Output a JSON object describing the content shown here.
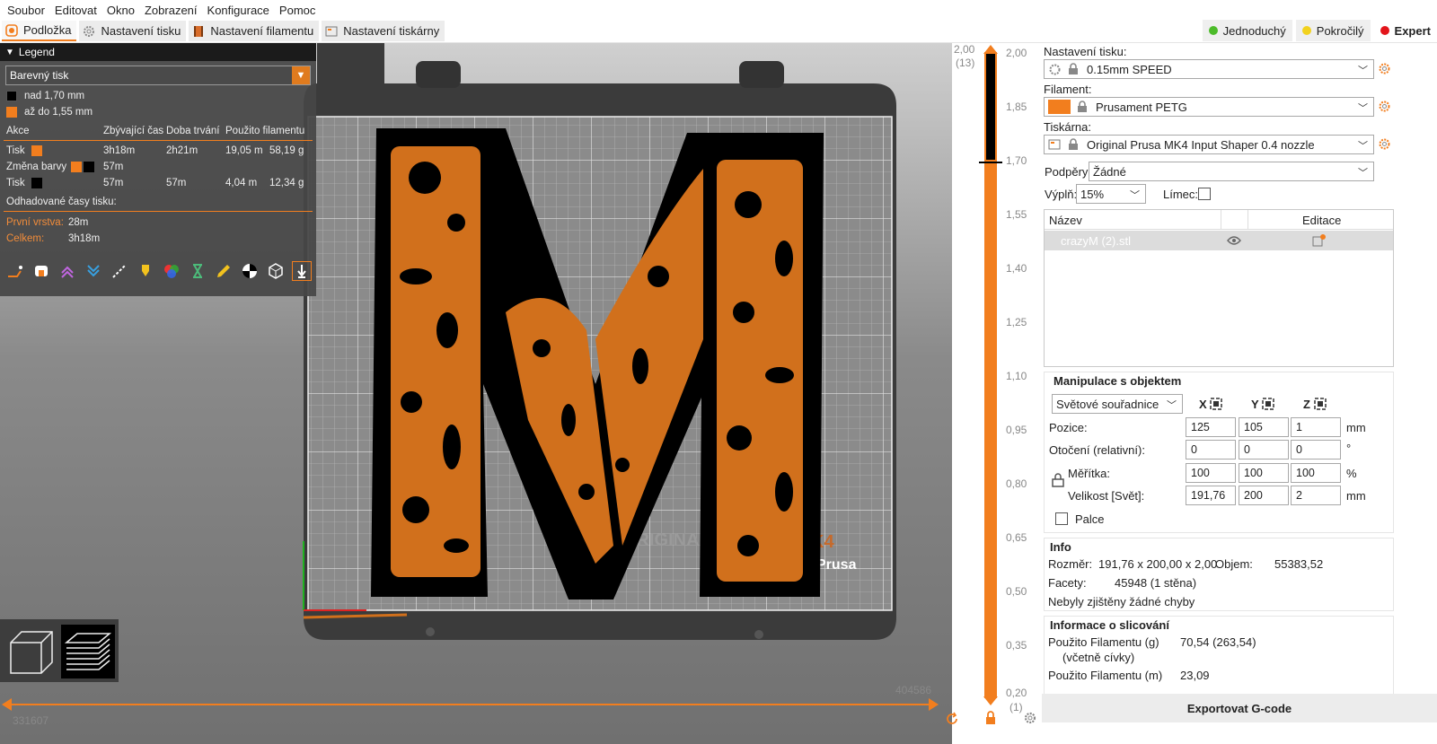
{
  "menu": [
    "Soubor",
    "Editovat",
    "Okno",
    "Zobrazení",
    "Konfigurace",
    "Pomoc"
  ],
  "tabs": [
    {
      "label": "Podložka",
      "icon": "plater-icon"
    },
    {
      "label": "Nastavení tisku",
      "icon": "gear-icon"
    },
    {
      "label": "Nastavení filamentu",
      "icon": "spool-icon"
    },
    {
      "label": "Nastavení tiskárny",
      "icon": "printer-icon"
    }
  ],
  "modes": [
    {
      "label": "Jednoduchý",
      "color": "#4cbb2a"
    },
    {
      "label": "Pokročilý",
      "color": "#f2d21e"
    },
    {
      "label": "Expert",
      "color": "#e3151b"
    }
  ],
  "legend": {
    "title": "Legend",
    "view_type": "Barevný tisk",
    "ranges": [
      {
        "label": "nad 1,70 mm",
        "color": "#000000"
      },
      {
        "label": "až do 1,55 mm",
        "color": "#f27e1e"
      }
    ],
    "columns": [
      "Akce",
      "Zbývající čas",
      "Doba trvání",
      "Použito filamentu"
    ],
    "rows": [
      {
        "action": "Tisk",
        "remaining": "3h18m",
        "duration": "2h21m",
        "length": "19,05 m",
        "weight": "58,19 g"
      },
      {
        "action": "Změna barvy",
        "remaining": "57m",
        "duration": "",
        "length": "",
        "weight": ""
      },
      {
        "action": "Tisk",
        "remaining": "57m",
        "duration": "57m",
        "length": "4,04 m",
        "weight": "12,34 g"
      }
    ],
    "estimates_title": "Odhadované časy tisku:",
    "first_layer_label": "První vrstva:",
    "first_layer_value": "28m",
    "total_label": "Celkem:",
    "total_value": "3h18m"
  },
  "bed_logo": {
    "text1": "ORIGINA",
    "text2": "K4",
    "text3": "Prusa"
  },
  "vertical_slider": {
    "top_value": "2,00",
    "top_layer": "(13)",
    "bottom_value": "0,20",
    "bottom_layer": "(1)",
    "ticks": [
      "2,00",
      "1,85",
      "1,70",
      "1,55",
      "1,40",
      "1,25",
      "1,10",
      "0,95",
      "0,80",
      "0,65",
      "0,50",
      "0,35",
      "0,20"
    ],
    "color_change_at": "1,70"
  },
  "horizontal_slider": {
    "left_value": "331607",
    "right_value": "404586"
  },
  "right_panel": {
    "print_settings_label": "Nastavení tisku:",
    "print_settings_value": "0.15mm SPEED",
    "filament_label": "Filament:",
    "filament_value": "Prusament PETG",
    "filament_color": "#f27e1e",
    "printer_label": "Tiskárna:",
    "printer_value": "Original Prusa MK4 Input Shaper 0.4 nozzle",
    "supports_label": "Podpěry:",
    "supports_value": "Žádné",
    "infill_label": "Výplň:",
    "infill_value": "15%",
    "brim_label": "Límec:",
    "list_col_name": "Název",
    "list_col_edit": "Editace",
    "object_name": "crazyM (2).stl",
    "manip_title": "Manipulace s objektem",
    "coord_system": "Světové souřadnice",
    "axes": [
      "X",
      "Y",
      "Z"
    ],
    "position_label": "Pozice:",
    "position": [
      "125",
      "105",
      "1"
    ],
    "position_unit": "mm",
    "rotation_label": "Otočení (relativní):",
    "rotation": [
      "0",
      "0",
      "0"
    ],
    "rotation_unit": "°",
    "scale_label": "Měřítka:",
    "scale": [
      "100",
      "100",
      "100"
    ],
    "scale_unit": "%",
    "size_label": "Velikost [Svět]:",
    "size": [
      "191,76",
      "200",
      "2"
    ],
    "size_unit": "mm",
    "inches_label": "Palce",
    "info_title": "Info",
    "size_info_label": "Rozměr:",
    "size_info_value": "191,76 x 200,00 x 2,00",
    "volume_label": "Objem:",
    "volume_value": "55383,52",
    "facets_label": "Facety:",
    "facets_value": "45948 (1 stěna)",
    "errors_text": "Nebyly zjištěny žádné chyby",
    "slice_title": "Informace o slicování",
    "used_g_label": "Použito Filamentu (g)",
    "used_g_sub": "(včetně cívky)",
    "used_g_value": "70,54 (263,54)",
    "used_m_label": "Použito Filamentu (m)",
    "used_m_value": "23,09",
    "export_label": "Exportovat G-code"
  }
}
